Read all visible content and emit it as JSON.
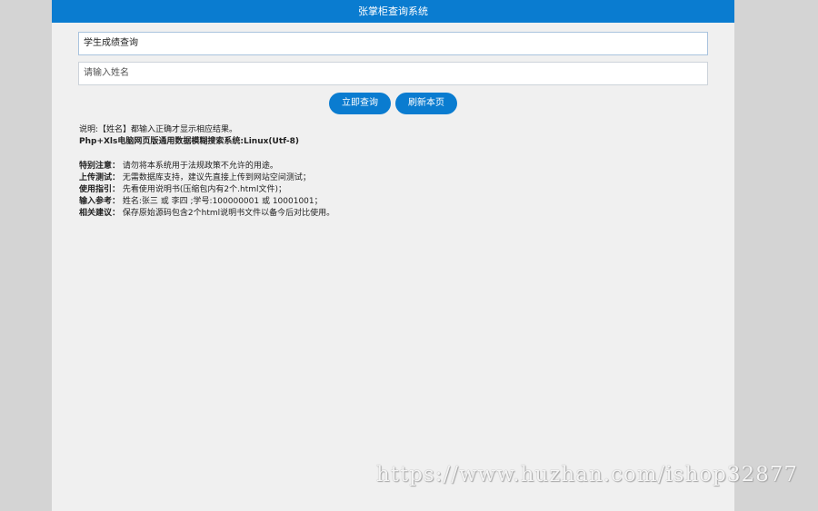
{
  "header": {
    "title": "张掌柜查询系统"
  },
  "form": {
    "query_type": "学生成绩查询",
    "name_placeholder": "请输入姓名",
    "submit_label": "立即查询",
    "refresh_label": "刷新本页"
  },
  "info": {
    "note": "说明:【姓名】都输入正确才显示相应结果。",
    "system_name": "Php+Xls电脑网页版通用数据模糊搜索系统:Linux(Utf-8)",
    "lines": [
      {
        "label": "特别注意：",
        "text": "请勿将本系统用于法规政策不允许的用途。"
      },
      {
        "label": "上传测试：",
        "text": "无需数据库支持，建议先直接上传到网站空间测试；"
      },
      {
        "label": "使用指引：",
        "text": "先看使用说明书(压缩包内有2个.html文件)；"
      },
      {
        "label": "输入参考：",
        "text": "姓名:张三 或 李四 ;学号:100000001 或 10001001；"
      },
      {
        "label": "相关建议：",
        "text": "保存原始源码包含2个html说明书文件以备今后对比使用。"
      }
    ]
  },
  "watermark": "https://www.huzhan.com/ishop32877",
  "colors": {
    "accent": "#0a7cd0",
    "panel": "#f0f0f0",
    "backdrop": "#d4d4d4"
  }
}
